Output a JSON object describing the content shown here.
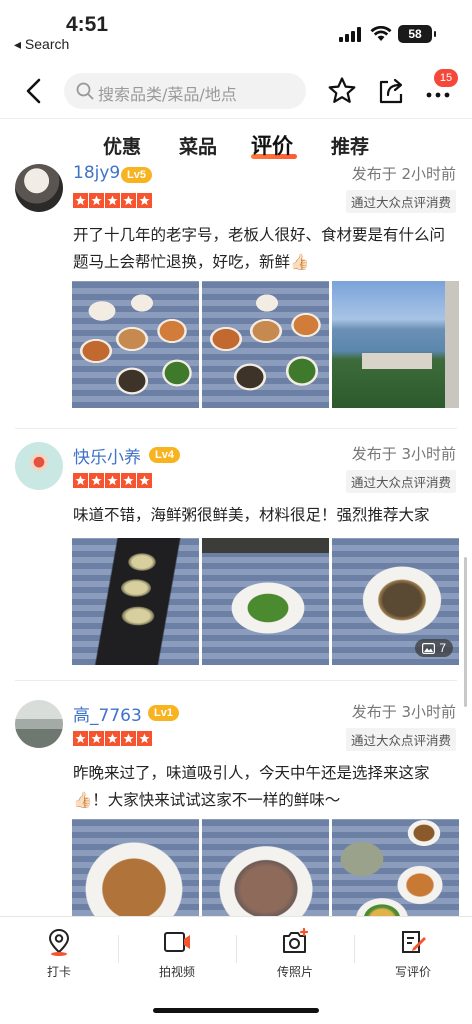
{
  "status": {
    "time": "4:51",
    "back_label": "◂ Search",
    "battery": "58"
  },
  "nav": {
    "search_placeholder": "搜索品类/菜品/地点",
    "badge_count": "15"
  },
  "tabs": [
    {
      "label": "优惠"
    },
    {
      "label": "菜品"
    },
    {
      "label": "评价",
      "active": true
    },
    {
      "label": "推荐"
    }
  ],
  "reviews": [
    {
      "user": "18jy9",
      "level": "Lv5",
      "posted": "发布于 2小时前",
      "verified": "通过大众点评消费",
      "rating": 5,
      "text": "开了十几年的老字号，老板人很好、食材要是有什么问题马上会帮忙退换，好吃，新鲜👍🏻",
      "photos": [
        "food-platter",
        "food-platter",
        "sea-view"
      ]
    },
    {
      "user": "快乐小养",
      "level": "Lv4",
      "posted": "发布于 3小时前",
      "verified": "通过大众点评消费",
      "rating": 5,
      "text": "味道不错，海鲜粥很鲜美，材料很足！强烈推荐大家",
      "photos": [
        "abalone",
        "greens",
        "clams"
      ],
      "photo_count": "7"
    },
    {
      "user": "高_7763",
      "level": "Lv1",
      "posted": "发布于 3小时前",
      "verified": "通过大众点评消费",
      "rating": 5,
      "text": "昨晚来过了，味道吸引人，今天中午还是选择来这家👍🏻！大家快来试试这家不一样的鲜味～",
      "photos": [
        "fried-rice",
        "shrimp",
        "dishes"
      ]
    }
  ],
  "bottom": [
    {
      "label": "打卡",
      "icon": "location-pin-icon"
    },
    {
      "label": "拍视频",
      "icon": "video-camera-icon"
    },
    {
      "label": "传照片",
      "icon": "photo-camera-icon"
    },
    {
      "label": "写评价",
      "icon": "write-review-icon"
    }
  ],
  "colors": {
    "accent": "#f5542e",
    "username": "#3f73c9",
    "level": "#f8b420"
  }
}
